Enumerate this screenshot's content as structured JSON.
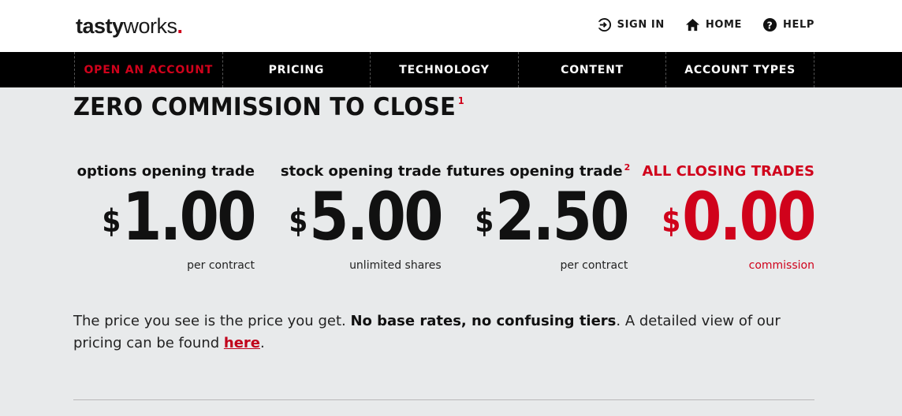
{
  "header": {
    "logo": {
      "part1": "tasty",
      "part2": "works",
      "dot": "."
    },
    "links": [
      {
        "label": "SIGN IN",
        "icon": "sign-in-icon"
      },
      {
        "label": "HOME",
        "icon": "home-icon"
      },
      {
        "label": "HELP",
        "icon": "help-icon"
      }
    ]
  },
  "nav": {
    "items": [
      {
        "label": "OPEN AN ACCOUNT",
        "active": true
      },
      {
        "label": "PRICING"
      },
      {
        "label": "TECHNOLOGY"
      },
      {
        "label": "CONTENT"
      },
      {
        "label": "ACCOUNT TYPES"
      }
    ]
  },
  "main": {
    "heading": "ZERO COMMISSION TO CLOSE",
    "heading_footnote": "1",
    "prices": [
      {
        "label": "options opening trade",
        "footnote": "",
        "currency": "$",
        "amount": "1.00",
        "sub": "per contract"
      },
      {
        "label": "stock opening trade",
        "footnote": "",
        "currency": "$",
        "amount": "5.00",
        "sub": "unlimited shares"
      },
      {
        "label": "futures opening trade",
        "footnote": "2",
        "currency": "$",
        "amount": "2.50",
        "sub": "per contract"
      },
      {
        "label": "ALL CLOSING TRADES",
        "footnote": "",
        "currency": "$",
        "amount": "0.00",
        "sub": "commission"
      }
    ],
    "description": {
      "part1": "The price you see is the price you get. ",
      "bold": "No base rates, no confusing tiers",
      "part2": ". A detailed view of our pricing can be found ",
      "link": "here",
      "part3": "."
    }
  },
  "colors": {
    "accent": "#d0021b",
    "nav_bg": "#000000",
    "page_bg": "#e8eaeb"
  }
}
